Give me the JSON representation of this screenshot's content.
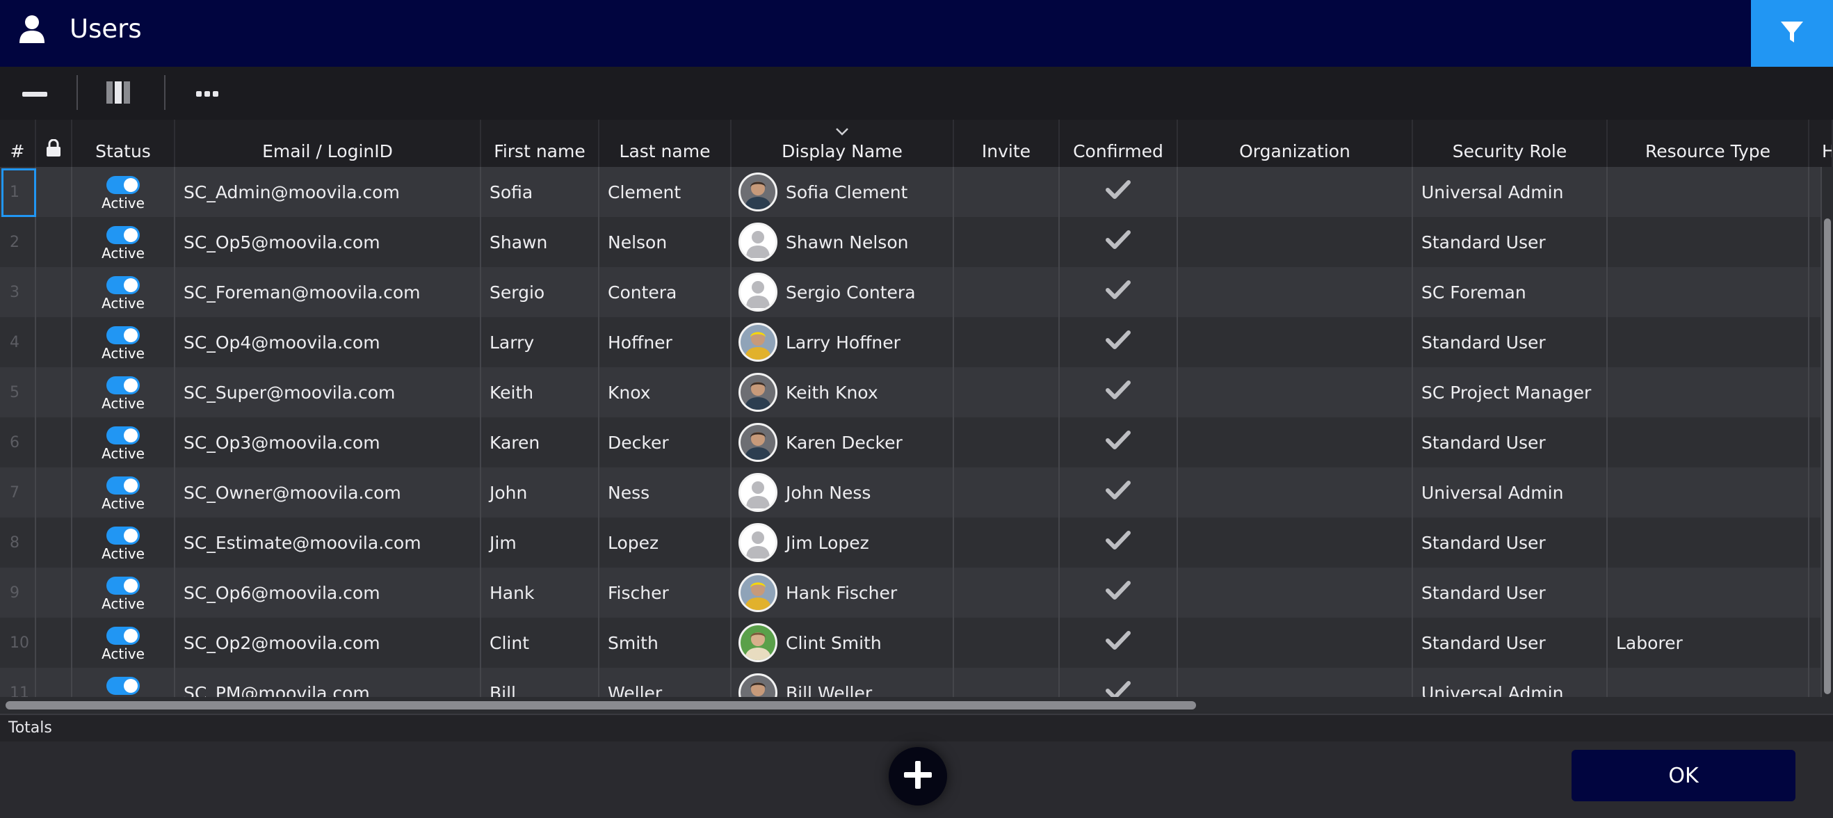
{
  "window": {
    "title": "Users"
  },
  "header_colors": {
    "titlebar": "#01053f",
    "accent": "#2196f3"
  },
  "icons": {
    "title": "user-icon",
    "filter": "filter-icon",
    "collapse": "minus-icon",
    "columns": "columns-icon",
    "more": "more-icon",
    "lock": "lock-icon",
    "confirmed": "checkmark-icon",
    "add": "plus-icon"
  },
  "columns": {
    "rownum": "#",
    "status": "Status",
    "email": "Email / LoginID",
    "first": "First name",
    "last": "Last name",
    "display": "Display Name",
    "invite": "Invite",
    "confirmed": "Confirmed",
    "organization": "Organization",
    "role": "Security Role",
    "resource": "Resource Type",
    "extra": "H"
  },
  "rows": [
    {
      "num": "1",
      "status": "Active",
      "email": "SC_Admin@moovila.com",
      "first": "Sofia",
      "last": "Clement",
      "display": "Sofia Clement",
      "avatar": "photo",
      "role": "Universal Admin",
      "resource": ""
    },
    {
      "num": "2",
      "status": "Active",
      "email": "SC_Op5@moovila.com",
      "first": "Shawn",
      "last": "Nelson",
      "display": "Shawn Nelson",
      "avatar": "placeholder",
      "role": "Standard User",
      "resource": ""
    },
    {
      "num": "3",
      "status": "Active",
      "email": "SC_Foreman@moovila.com",
      "first": "Sergio",
      "last": "Contera",
      "display": "Sergio Contera",
      "avatar": "placeholder",
      "role": "SC Foreman",
      "resource": ""
    },
    {
      "num": "4",
      "status": "Active",
      "email": "SC_Op4@moovila.com",
      "first": "Larry",
      "last": "Hoffner",
      "display": "Larry Hoffner",
      "avatar": "photo-hardhat",
      "role": "Standard User",
      "resource": ""
    },
    {
      "num": "5",
      "status": "Active",
      "email": "SC_Super@moovila.com",
      "first": "Keith",
      "last": "Knox",
      "display": "Keith Knox",
      "avatar": "photo",
      "role": "SC Project Manager",
      "resource": ""
    },
    {
      "num": "6",
      "status": "Active",
      "email": "SC_Op3@moovila.com",
      "first": "Karen",
      "last": "Decker",
      "display": "Karen Decker",
      "avatar": "photo",
      "role": "Standard User",
      "resource": ""
    },
    {
      "num": "7",
      "status": "Active",
      "email": "SC_Owner@moovila.com",
      "first": "John",
      "last": "Ness",
      "display": "John Ness",
      "avatar": "placeholder",
      "role": "Universal Admin",
      "resource": ""
    },
    {
      "num": "8",
      "status": "Active",
      "email": "SC_Estimate@moovila.com",
      "first": "Jim",
      "last": "Lopez",
      "display": "Jim Lopez",
      "avatar": "placeholder",
      "role": "Standard User",
      "resource": ""
    },
    {
      "num": "9",
      "status": "Active",
      "email": "SC_Op6@moovila.com",
      "first": "Hank",
      "last": "Fischer",
      "display": "Hank Fischer",
      "avatar": "photo-hardhat",
      "role": "Standard User",
      "resource": ""
    },
    {
      "num": "10",
      "status": "Active",
      "email": "SC_Op2@moovila.com",
      "first": "Clint",
      "last": "Smith",
      "display": "Clint Smith",
      "avatar": "photo-green",
      "role": "Standard User",
      "resource": "Laborer"
    },
    {
      "num": "11",
      "status": "Active",
      "email": "SC_PM@moovila.com",
      "first": "Bill",
      "last": "Weller",
      "display": "Bill Weller",
      "avatar": "photo",
      "role": "Universal Admin",
      "resource": ""
    }
  ],
  "totals": {
    "label": "Totals"
  },
  "footer": {
    "ok_label": "OK"
  }
}
